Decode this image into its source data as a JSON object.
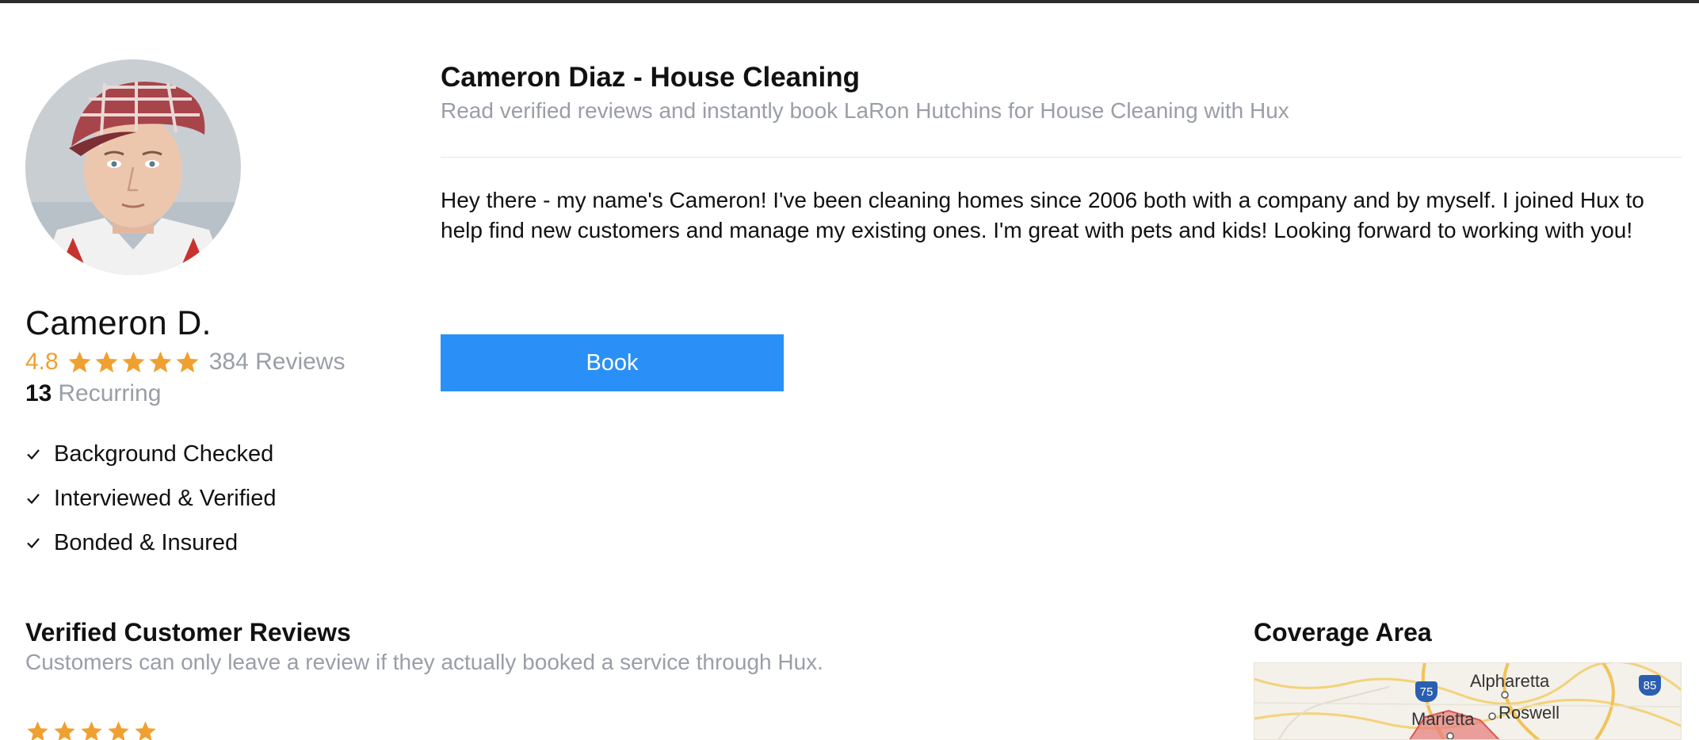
{
  "profile": {
    "name": "Cameron D.",
    "rating": "4.8",
    "star_count": 5,
    "reviews_count": "384 Reviews",
    "recurring_count": "13",
    "recurring_label": "Recurring",
    "badges": [
      "Background Checked",
      "Interviewed & Verified",
      "Bonded & Insured"
    ]
  },
  "header": {
    "title": "Cameron Diaz - House Cleaning",
    "subtitle": "Read verified reviews and instantly book LaRon Hutchins for House Cleaning with Hux"
  },
  "bio": "Hey there - my name's Cameron! I've been cleaning homes since 2006 both with a company and by myself. I joined Hux to help find new customers and manage my existing ones. I'm great with pets and kids! Looking forward to working with you!",
  "book_button": {
    "label": "Book"
  },
  "reviews": {
    "title": "Verified Customer Reviews",
    "subtitle": "Customers can only leave a review if they actually booked a service through Hux.",
    "first_review_stars": 5
  },
  "coverage": {
    "title": "Coverage Area",
    "map_labels": {
      "alpharetta": "Alpharetta",
      "roswell": "Roswell",
      "marietta": "Marietta",
      "i75": "75",
      "i85": "85"
    }
  },
  "colors": {
    "accent": "#2a90f7",
    "star": "#f0a030",
    "muted_text": "#9a9ea6",
    "top_bar": "#2b2b2b"
  }
}
